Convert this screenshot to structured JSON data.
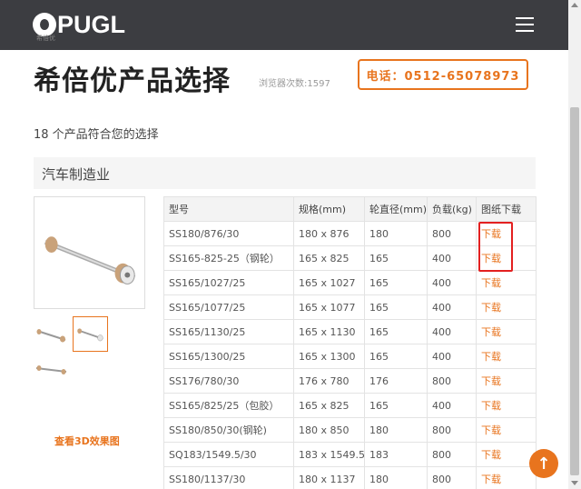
{
  "header": {
    "logo_text": "PUGL",
    "logo_sub": "希倍优",
    "menu_icon": "hamburger-icon"
  },
  "page": {
    "title": "希倍优产品选择",
    "view_count": "浏览器次数:1597",
    "phone": "电话：0512-65078973",
    "result_count": "18 个产品符合您的选择",
    "category": "汽车制造业",
    "view3d": "查看3D效果图"
  },
  "table": {
    "headers": [
      "型号",
      "规格(mm)",
      "轮直径(mm)",
      "负载(kg)",
      "图纸下载"
    ],
    "rows": [
      [
        "SS180/876/30",
        "180 x 876",
        "180",
        "800",
        "下载"
      ],
      [
        "SS165-825-25（钢轮）",
        "165 x 825",
        "165",
        "400",
        "下载"
      ],
      [
        "SS165/1027/25",
        "165 x 1027",
        "165",
        "400",
        "下载"
      ],
      [
        "SS165/1077/25",
        "165 x 1077",
        "165",
        "400",
        "下载"
      ],
      [
        "SS165/1130/25",
        "165 x 1130",
        "165",
        "400",
        "下载"
      ],
      [
        "SS165/1300/25",
        "165 x 1300",
        "165",
        "400",
        "下载"
      ],
      [
        "SS176/780/30",
        "176 x 780",
        "176",
        "800",
        "下载"
      ],
      [
        "SS165/825/25（包胶）",
        "165 x 825",
        "165",
        "400",
        "下载"
      ],
      [
        "SS180/850/30(钢轮)",
        "180 x 850",
        "180",
        "800",
        "下载"
      ],
      [
        "SQ183/1549.5/30",
        "183 x 1549.5",
        "183",
        "800",
        "下载"
      ],
      [
        "SS180/1137/30",
        "180 x 1137",
        "180",
        "800",
        "下载"
      ]
    ]
  },
  "colors": {
    "accent": "#e8741e",
    "header_bg": "#3c3d41",
    "highlight": "#e32020"
  },
  "back_to_top_icon": "arrow-up-icon"
}
